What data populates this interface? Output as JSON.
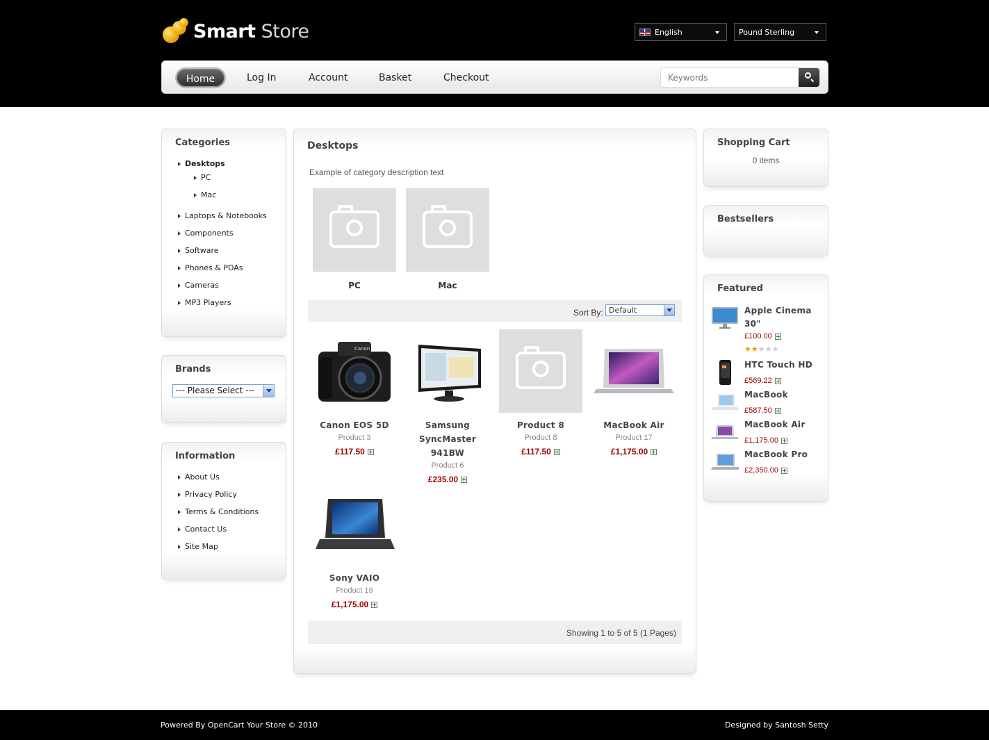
{
  "header": {
    "logo_bold": "Smart",
    "logo_light": "Store",
    "language": "English",
    "currency": "Pound Sterling"
  },
  "nav": {
    "items": [
      "Home",
      "Log In",
      "Account",
      "Basket",
      "Checkout"
    ],
    "search_placeholder": "Keywords"
  },
  "categories": {
    "title": "Categories",
    "items": [
      {
        "label": "Desktops",
        "active": true
      },
      {
        "label": "PC"
      },
      {
        "label": "Mac"
      },
      {
        "label": "Laptops & Notebooks"
      },
      {
        "label": "Components"
      },
      {
        "label": "Software"
      },
      {
        "label": "Phones & PDAs"
      },
      {
        "label": "Cameras"
      },
      {
        "label": "MP3 Players"
      }
    ]
  },
  "brands": {
    "title": "Brands",
    "selected": "--- Please Select ---"
  },
  "information": {
    "title": "Information",
    "items": [
      "About Us",
      "Privacy Policy",
      "Terms & Conditions",
      "Contact Us",
      "Site Map"
    ]
  },
  "main": {
    "title": "Desktops",
    "description": "Example of category description text",
    "subcategories": [
      "PC",
      "Mac"
    ],
    "sort_label": "Sort By:",
    "sort_value": "Default",
    "products": [
      {
        "name": "Canon EOS 5D",
        "model": "Product 3",
        "price": "£117.50",
        "image": "camera"
      },
      {
        "name": "Samsung SyncMaster 941BW",
        "model": "Product 6",
        "price": "£235.00",
        "image": "monitor"
      },
      {
        "name": "Product 8",
        "model": "Product 8",
        "price": "£117.50",
        "image": "placeholder"
      },
      {
        "name": "MacBook Air",
        "model": "Product 17",
        "price": "£1,175.00",
        "image": "laptop-silver"
      },
      {
        "name": "Sony VAIO",
        "model": "Product 19",
        "price": "£1,175.00",
        "image": "laptop-black"
      }
    ],
    "pagination": "Showing 1 to 5 of 5 (1 Pages)"
  },
  "cart": {
    "title": "Shopping Cart",
    "status": "0 items"
  },
  "bestsellers": {
    "title": "Bestsellers"
  },
  "featured": {
    "title": "Featured",
    "items": [
      {
        "name": "Apple Cinema 30\"",
        "price": "£100.00",
        "rating": 2,
        "image": "cinema-display"
      },
      {
        "name": "HTC Touch HD",
        "price": "£569.22",
        "image": "phone"
      },
      {
        "name": "MacBook",
        "price": "£587.50",
        "image": "laptop-white"
      },
      {
        "name": "MacBook Air",
        "price": "£1,175.00",
        "image": "laptop-silver"
      },
      {
        "name": "MacBook Pro",
        "price": "£2,350.00",
        "image": "laptop-pro"
      }
    ]
  },
  "footer": {
    "left": "Powered By OpenCart Your Store © 2010",
    "right": "Designed by Santosh Setty"
  },
  "colors": {
    "price": "#990000",
    "header_bg": "#000000",
    "accent_star": "#f3a000"
  }
}
